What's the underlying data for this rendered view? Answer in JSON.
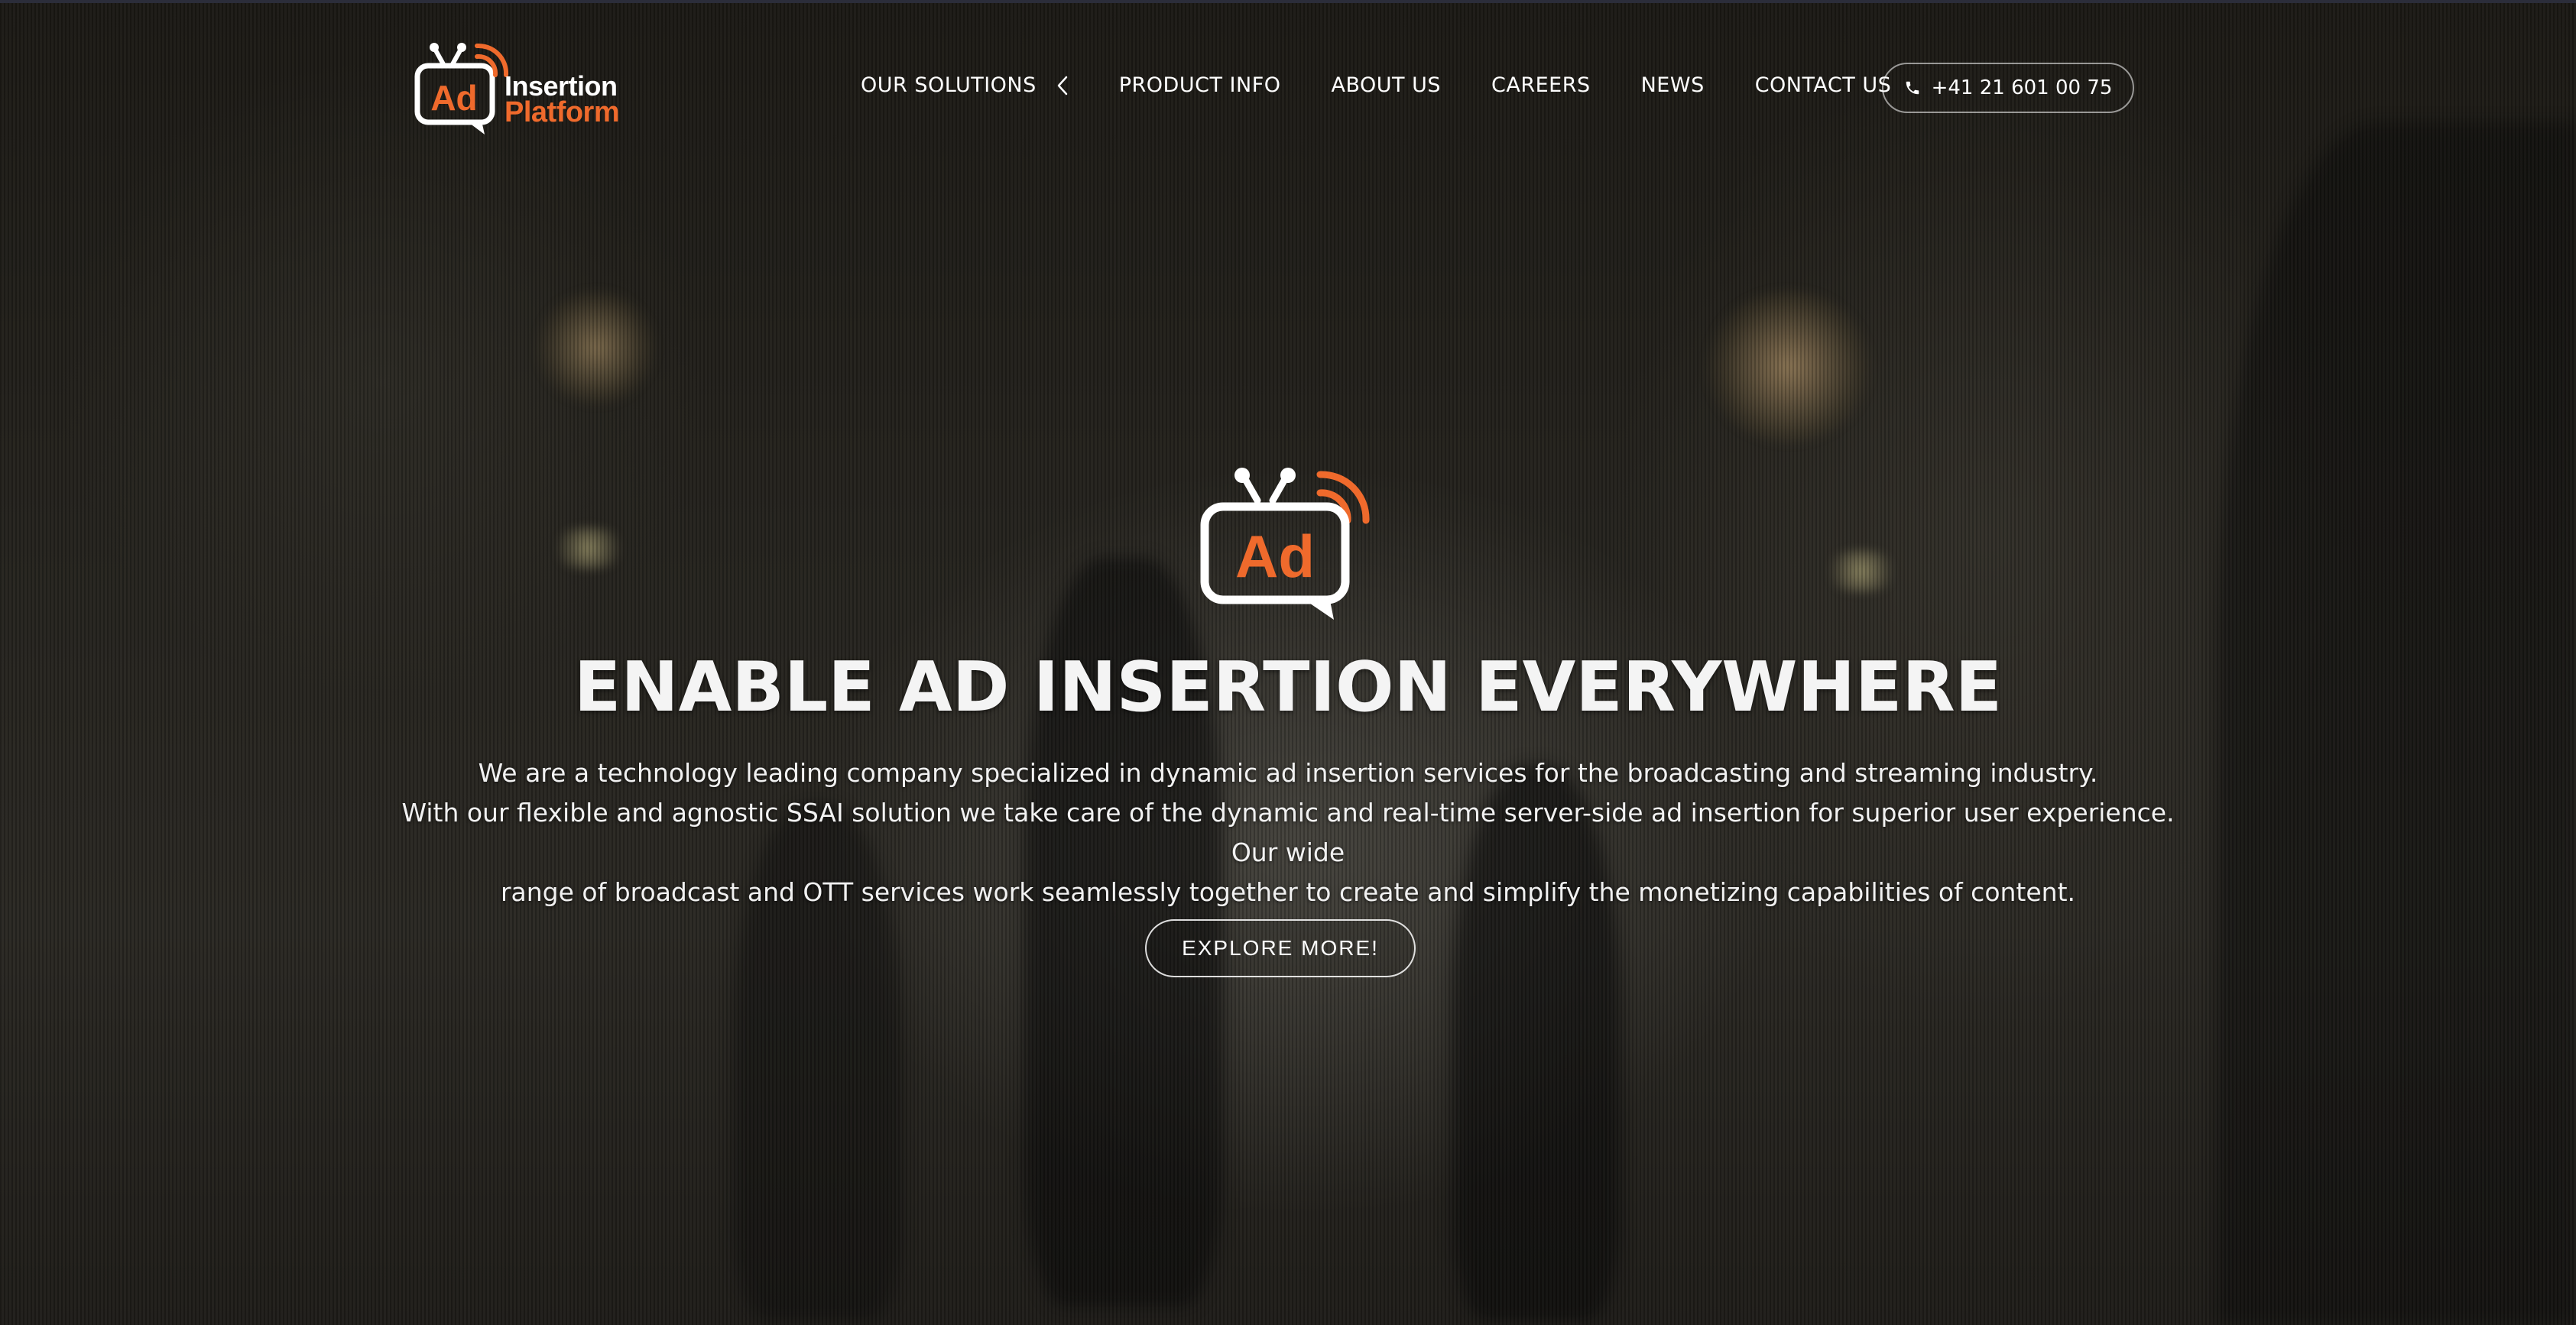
{
  "brand": {
    "name_line1": "Insertion",
    "name_line2": "Platform",
    "badge_text": "Ad",
    "accent_color": "#ef6a2c",
    "text_color": "#ffffff"
  },
  "nav": {
    "items": [
      {
        "label": "OUR SOLUTIONS",
        "icon": "chevron-left-icon"
      },
      {
        "label": "PRODUCT INFO"
      },
      {
        "label": "ABOUT US"
      },
      {
        "label": "CAREERS"
      },
      {
        "label": "NEWS"
      },
      {
        "label": "CONTACT US"
      }
    ],
    "phone": {
      "icon": "phone-icon",
      "label": "+41 21 601 00 75"
    }
  },
  "hero": {
    "logo_badge_text": "Ad",
    "title": "ENABLE AD INSERTION EVERYWHERE",
    "paragraph_line1": "We are a technology leading company specialized in dynamic ad insertion services for the broadcasting and streaming industry.",
    "paragraph_line2": "With our flexible and agnostic SSAI solution we take care of the dynamic and real-time server-side ad insertion for superior user experience. Our wide",
    "paragraph_line3": "range of broadcast and OTT services work seamlessly together to create and simplify the monetizing capabilities of content.",
    "cta_label": "EXPLORE MORE!"
  }
}
